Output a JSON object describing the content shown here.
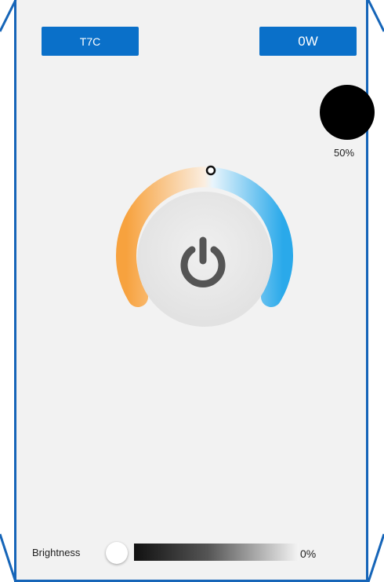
{
  "header": {
    "model_label": "T7C",
    "power_label": "0W"
  },
  "color_indicator": {
    "color": "#000000",
    "percent": "50%"
  },
  "dial": {
    "warm_color": "#f7a23e",
    "cool_color": "#2aa9ea",
    "icon": "power-icon"
  },
  "brightness": {
    "label": "Brightness",
    "value_text": "0%",
    "value": 0
  }
}
